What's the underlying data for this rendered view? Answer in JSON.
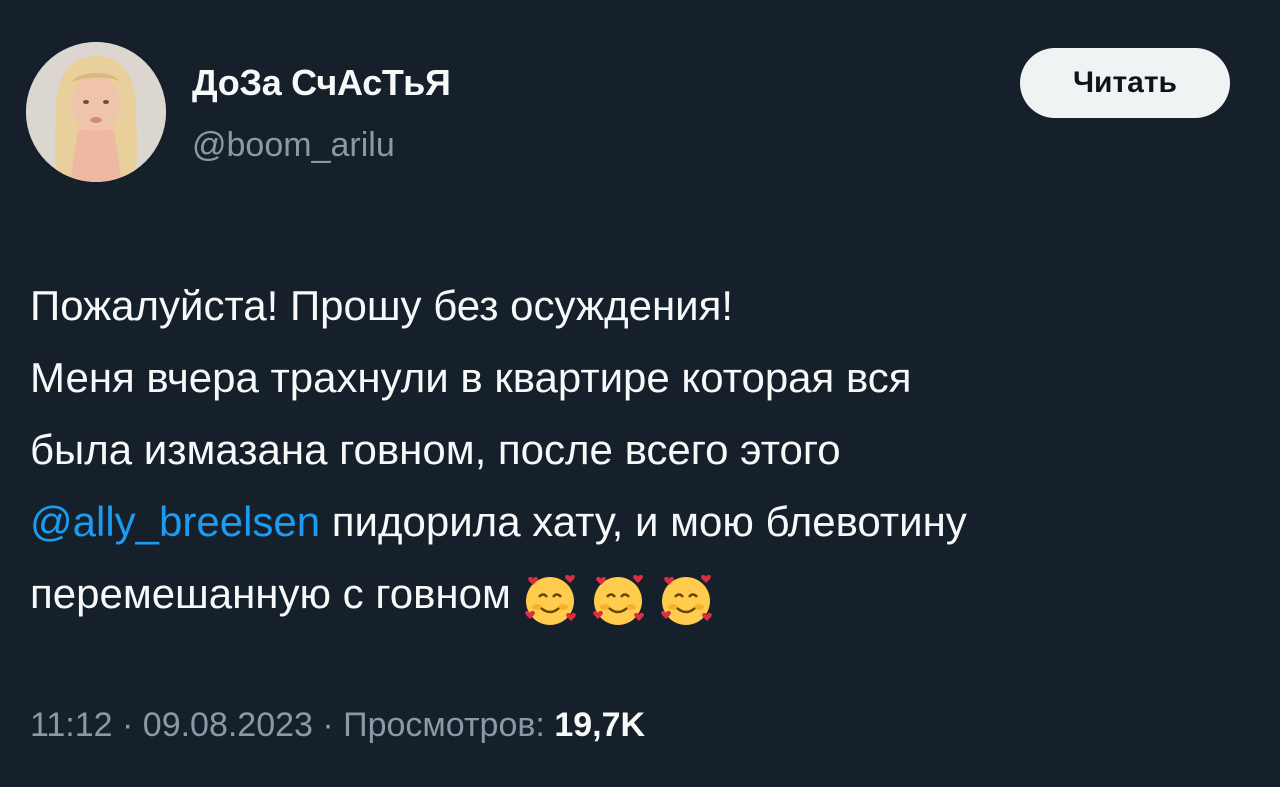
{
  "author": {
    "display_name": "ДоЗа СчАсТьЯ",
    "handle": "@boom_arilu"
  },
  "follow_button": {
    "label": "Читать"
  },
  "tweet": {
    "line1": "Пожалуйста! Прошу без осуждения!",
    "line2": "Меня вчера трахнули в квартире которая вся",
    "line3": "была измазана говном, после всего этого",
    "mention": "@ally_breelsen",
    "line4_rest": " пидорила хату, и мою блевотину",
    "line5": "перемешанную с говном",
    "emojis": [
      "smiling-face-with-hearts",
      "smiling-face-with-hearts",
      "smiling-face-with-hearts"
    ]
  },
  "meta": {
    "time": "11:12",
    "separator": " · ",
    "date": "09.08.2023",
    "views_label": "Просмотров: ",
    "views_count": "19,7K"
  },
  "colors": {
    "background": "#15202b",
    "text": "#f7f9f9",
    "muted": "#8b98a5",
    "link": "#1d9bf0",
    "button_bg": "#eff3f4"
  }
}
